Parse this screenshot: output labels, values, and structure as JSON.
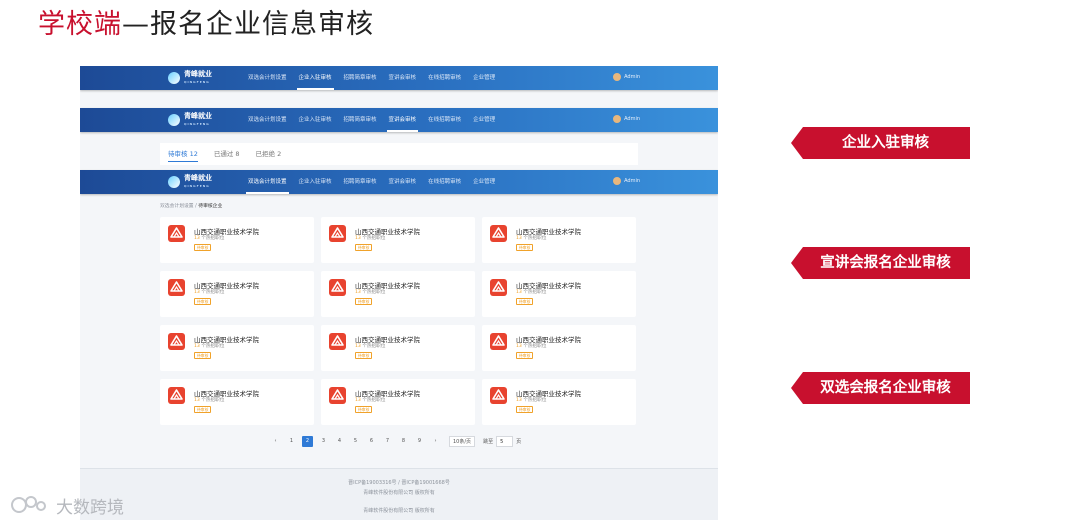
{
  "slide": {
    "title_highlight": "学校端",
    "title_rest": "—报名企业信息审核"
  },
  "app": {
    "logo_text": "青峰就业",
    "logo_sub": "QINGFENG",
    "user_name": "Admin",
    "menu": [
      "双选会计划设置",
      "企业入驻审核",
      "招聘简章审核",
      "宣讲会审核",
      "在线招聘审核",
      "企业管理"
    ]
  },
  "middle_tabs": {
    "items": [
      "待审核 12",
      "已通过 8",
      "已拒绝 2"
    ]
  },
  "breadcrumb": {
    "root": "双选会计划设置",
    "separator": " / ",
    "current": "待审核企业"
  },
  "card": {
    "name": "山西交通职业技术学院",
    "count_num": "13",
    "count_suffix": " 个热招职位",
    "badge": "待审核"
  },
  "pagination": {
    "prev": "‹",
    "pages": [
      "1",
      "2",
      "3",
      "4",
      "5",
      "6",
      "7",
      "8",
      "9"
    ],
    "current": "2",
    "next": "›",
    "page_size": "10条/页",
    "goto_label": "跳至",
    "goto_value": "5",
    "page_unit": "页"
  },
  "footer": {
    "line1": "晋ICP备19003316号 / 晋ICP备19001668号",
    "line2": "青峰软件股份有限公司 版权所有",
    "line3": "青峰软件股份有限公司 版权所有"
  },
  "callouts": [
    "企业入驻审核",
    "宣讲会报名企业审核",
    "双选会报名企业审核"
  ],
  "watermark": {
    "text": "大数跨境"
  },
  "colors": {
    "accent_red": "#c8102e",
    "nav_blue": "#2a6fc0",
    "active_blue": "#2f7ad6",
    "badge_orange": "#f0a22a"
  }
}
